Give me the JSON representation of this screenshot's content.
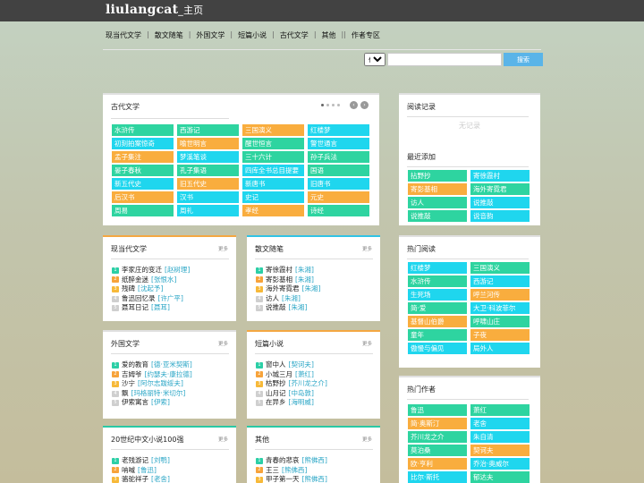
{
  "brand": {
    "name": "liulangcat",
    "sub": "_主页"
  },
  "nav": [
    "现当代文学",
    "散文随笔",
    "外国文学",
    "短篇小说",
    "古代文学",
    "其他",
    "作者专区"
  ],
  "nav_separators": [
    "|",
    "|",
    "|",
    "|",
    "|",
    "||"
  ],
  "search": {
    "select_value": "任意",
    "button_label": "搜索"
  },
  "ancient": {
    "title": "古代文学",
    "tags": [
      [
        "水浒传",
        "green"
      ],
      [
        "西游记",
        "green"
      ],
      [
        "三国演义",
        "orange"
      ],
      [
        "红楼梦",
        "cyan"
      ],
      [
        "初刻拍案惊奇",
        "cyan"
      ],
      [
        "喻世明言",
        "orange"
      ],
      [
        "醒世恒言",
        "green"
      ],
      [
        "警世通言",
        "cyan"
      ],
      [
        "孟子集注",
        "orange"
      ],
      [
        "梦溪笔谈",
        "cyan"
      ],
      [
        "三十六计",
        "green"
      ],
      [
        "孙子兵法",
        "green"
      ],
      [
        "晏子春秋",
        "green"
      ],
      [
        "孔子集语",
        "green"
      ],
      [
        "四库全书总目提要",
        "cyan"
      ],
      [
        "国语",
        "green"
      ],
      [
        "新五代史",
        "cyan"
      ],
      [
        "旧五代史",
        "orange"
      ],
      [
        "新唐书",
        "cyan"
      ],
      [
        "旧唐书",
        "cyan"
      ],
      [
        "后汉书",
        "orange"
      ],
      [
        "汉书",
        "cyan"
      ],
      [
        "史记",
        "cyan"
      ],
      [
        "元史",
        "orange"
      ],
      [
        "周易",
        "green"
      ],
      [
        "周礼",
        "cyan"
      ],
      [
        "孝经",
        "orange"
      ],
      [
        "诗经",
        "green"
      ]
    ],
    "prev": "‹",
    "next": "›"
  },
  "modern": {
    "title": "现当代文学",
    "more": "更多",
    "items": [
      [
        "李家庄的变迁",
        "赵树理"
      ],
      [
        "纸醉金迷",
        "张恨水"
      ],
      [
        "残碑",
        "沈起予"
      ],
      [
        "鲁迅回忆录",
        "许广平"
      ],
      [
        "聂耳日记",
        "聂耳"
      ]
    ]
  },
  "essay": {
    "title": "散文随笔",
    "more": "更多",
    "items": [
      [
        "寄徐霞村",
        "朱湘"
      ],
      [
        "寄彭基相",
        "朱湘"
      ],
      [
        "海外寄霓君",
        "朱湘"
      ],
      [
        "访人",
        "朱湘"
      ],
      [
        "说推敲",
        "朱湘"
      ]
    ]
  },
  "foreign": {
    "title": "外国文学",
    "more": "更多",
    "items": [
      [
        "爱的教育",
        "德·亚米契斯"
      ],
      [
        "吉姆爷",
        "约瑟夫·康拉德"
      ],
      [
        "沙宁",
        "阿尔志跋绥夫"
      ],
      [
        "飘",
        "玛格丽特·米切尔"
      ],
      [
        "伊索寓言",
        "伊索"
      ]
    ]
  },
  "short": {
    "title": "短篇小说",
    "more": "更多",
    "items": [
      [
        "窗中人",
        "契诃夫"
      ],
      [
        "小城三月",
        "萧红"
      ],
      [
        "枯野抄",
        "芥川龙之介"
      ],
      [
        "山月记",
        "中岛敦"
      ],
      [
        "在异乡",
        "海明威"
      ]
    ]
  },
  "c20": {
    "title": "20世纪中文小说100强",
    "more": "更多",
    "items": [
      [
        "老残游记",
        "刘鹗"
      ],
      [
        "呐喊",
        "鲁迅"
      ],
      [
        "骆驼祥子",
        "老舍"
      ]
    ]
  },
  "other": {
    "title": "其他",
    "more": "更多",
    "items": [
      [
        "青春的悲哀",
        "熊佛西"
      ],
      [
        "王三",
        "熊佛西"
      ],
      [
        "甲子第一天",
        "熊佛西"
      ]
    ]
  },
  "history": {
    "title": "阅读记录",
    "empty": "无记录"
  },
  "recent": {
    "title": "最近添加",
    "tags": [
      [
        "拈野抄",
        "green"
      ],
      [
        "寄徐霞村",
        "cyan"
      ],
      [
        "寄彭基相",
        "orange"
      ],
      [
        "海外寄霓君",
        "green"
      ],
      [
        "访人",
        "green"
      ],
      [
        "说推敲",
        "cyan"
      ],
      [
        "说推敲",
        "green"
      ],
      [
        "说音韵",
        "cyan"
      ]
    ]
  },
  "hot_read": {
    "title": "热门阅读",
    "tags": [
      [
        "红楼梦",
        "cyan"
      ],
      [
        "三国演义",
        "green"
      ],
      [
        "水浒传",
        "green"
      ],
      [
        "西游记",
        "cyan"
      ],
      [
        "生死场",
        "cyan"
      ],
      [
        "呼兰河传",
        "orange"
      ],
      [
        "简·爱",
        "green"
      ],
      [
        "大卫·科波菲尔",
        "cyan"
      ],
      [
        "基督山伯爵",
        "orange"
      ],
      [
        "呼啸山庄",
        "green"
      ],
      [
        "童年",
        "green"
      ],
      [
        "子夜",
        "orange"
      ],
      [
        "傲慢与偏见",
        "cyan"
      ],
      [
        "局外人",
        "cyan"
      ]
    ]
  },
  "hot_author": {
    "title": "热门作者",
    "tags": [
      [
        "鲁迅",
        "green"
      ],
      [
        "萧红",
        "green"
      ],
      [
        "简·奥斯汀",
        "orange"
      ],
      [
        "老舍",
        "cyan"
      ],
      [
        "芥川龙之介",
        "green"
      ],
      [
        "朱自清",
        "cyan"
      ],
      [
        "莫泊桑",
        "green"
      ],
      [
        "契诃夫",
        "orange"
      ],
      [
        "欧·亨利",
        "orange"
      ],
      [
        "乔治·奥威尔",
        "cyan"
      ],
      [
        "比尔·斯托",
        "cyan"
      ],
      [
        "郁达夫",
        "green"
      ]
    ]
  }
}
